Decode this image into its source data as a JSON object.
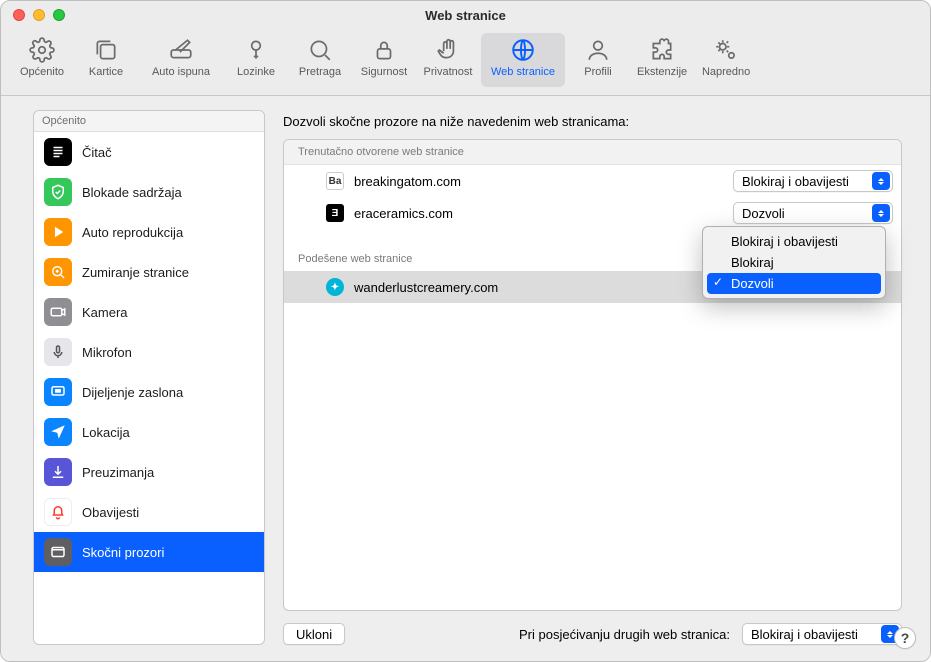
{
  "window": {
    "title": "Web stranice"
  },
  "toolbar": {
    "items": [
      {
        "label": "Općenito"
      },
      {
        "label": "Kartice"
      },
      {
        "label": "Auto ispuna"
      },
      {
        "label": "Lozinke"
      },
      {
        "label": "Pretraga"
      },
      {
        "label": "Sigurnost"
      },
      {
        "label": "Privatnost"
      },
      {
        "label": "Web stranice"
      },
      {
        "label": "Profili"
      },
      {
        "label": "Ekstenzije"
      },
      {
        "label": "Napredno"
      }
    ]
  },
  "sidebar": {
    "header": "Općenito",
    "items": [
      {
        "label": "Čitač"
      },
      {
        "label": "Blokade sadržaja"
      },
      {
        "label": "Auto reprodukcija"
      },
      {
        "label": "Zumiranje stranice"
      },
      {
        "label": "Kamera"
      },
      {
        "label": "Mikrofon"
      },
      {
        "label": "Dijeljenje zaslona"
      },
      {
        "label": "Lokacija"
      },
      {
        "label": "Preuzimanja"
      },
      {
        "label": "Obavijesti"
      },
      {
        "label": "Skočni prozori"
      }
    ]
  },
  "main": {
    "heading": "Dozvoli skočne prozore na niže navedenim web stranicama:",
    "section_open_header": "Trenutačno otvorene web stranice",
    "section_configured_header": "Podešene web stranice",
    "open_sites": [
      {
        "domain": "breakingatom.com",
        "setting": "Blokiraj i obavijesti"
      },
      {
        "domain": "eraceramics.com",
        "setting": "Dozvoli"
      }
    ],
    "configured_sites": [
      {
        "domain": "wanderlustcreamery.com",
        "setting": "Dozvoli"
      }
    ],
    "popup_menu": {
      "options": [
        "Blokiraj i obavijesti",
        "Blokiraj",
        "Dozvoli"
      ],
      "selected_index": 2
    },
    "remove_button": "Ukloni",
    "default_label": "Pri posjećivanju drugih web stranica:",
    "default_value": "Blokiraj i obavijesti"
  },
  "help": "?"
}
